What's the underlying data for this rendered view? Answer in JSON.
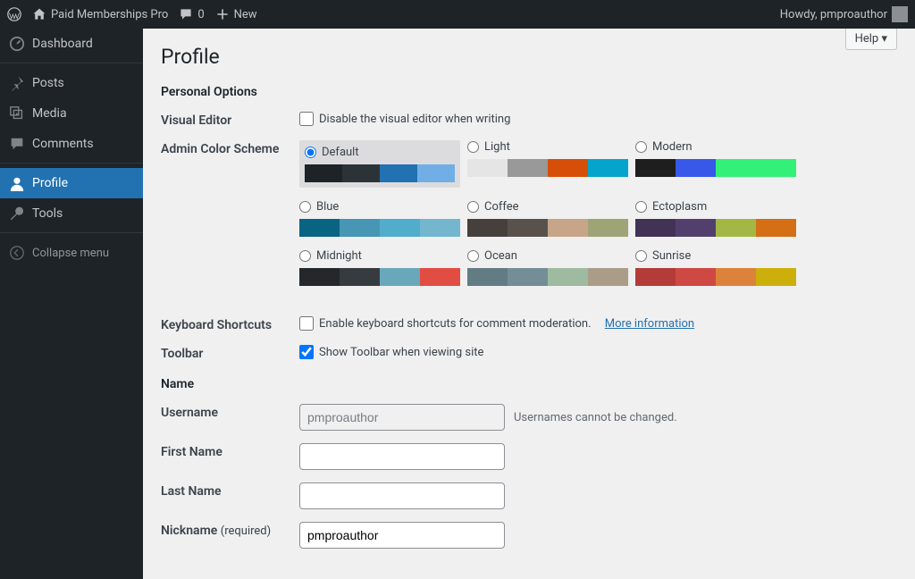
{
  "adminbar": {
    "site_title": "Paid Memberships Pro",
    "comments_count": "0",
    "new_label": "New",
    "howdy": "Howdy, pmproauthor"
  },
  "sidebar": {
    "dashboard": "Dashboard",
    "posts": "Posts",
    "media": "Media",
    "comments": "Comments",
    "profile": "Profile",
    "tools": "Tools",
    "collapse": "Collapse menu"
  },
  "help_label": "Help",
  "page_title": "Profile",
  "sections": {
    "personal_options": "Personal Options",
    "name": "Name"
  },
  "visual_editor": {
    "label": "Visual Editor",
    "checkbox_label": "Disable the visual editor when writing"
  },
  "color_scheme": {
    "label": "Admin Color Scheme",
    "options": [
      {
        "name": "Default",
        "selected": true,
        "colors": [
          "#1d2327",
          "#2c3338",
          "#2271b1",
          "#72aee6"
        ]
      },
      {
        "name": "Light",
        "selected": false,
        "colors": [
          "#e5e5e5",
          "#999999",
          "#d64e07",
          "#04a4cc"
        ]
      },
      {
        "name": "Modern",
        "selected": false,
        "colors": [
          "#1e1e1e",
          "#3858e9",
          "#33f078",
          "#33f078"
        ]
      },
      {
        "name": "Blue",
        "selected": false,
        "colors": [
          "#096484",
          "#4796b3",
          "#52accc",
          "#74B6CE"
        ]
      },
      {
        "name": "Coffee",
        "selected": false,
        "colors": [
          "#46403c",
          "#59524c",
          "#c7a589",
          "#9ea476"
        ]
      },
      {
        "name": "Ectoplasm",
        "selected": false,
        "colors": [
          "#413256",
          "#523f6d",
          "#a3b745",
          "#d46f15"
        ]
      },
      {
        "name": "Midnight",
        "selected": false,
        "colors": [
          "#25282b",
          "#363b3f",
          "#69a8bb",
          "#e14d43"
        ]
      },
      {
        "name": "Ocean",
        "selected": false,
        "colors": [
          "#627c83",
          "#738e96",
          "#9ebaa0",
          "#aa9d88"
        ]
      },
      {
        "name": "Sunrise",
        "selected": false,
        "colors": [
          "#b43c38",
          "#cf4944",
          "#dd823b",
          "#ccaf0b"
        ]
      }
    ]
  },
  "keyboard": {
    "label": "Keyboard Shortcuts",
    "checkbox_label": "Enable keyboard shortcuts for comment moderation.",
    "more_info": "More information"
  },
  "toolbar": {
    "label": "Toolbar",
    "checkbox_label": "Show Toolbar when viewing site"
  },
  "username": {
    "label": "Username",
    "value": "pmproauthor",
    "note": "Usernames cannot be changed."
  },
  "first_name": {
    "label": "First Name",
    "value": ""
  },
  "last_name": {
    "label": "Last Name",
    "value": ""
  },
  "nickname": {
    "label": "Nickname",
    "required_suffix": "(required)",
    "value": "pmproauthor"
  }
}
